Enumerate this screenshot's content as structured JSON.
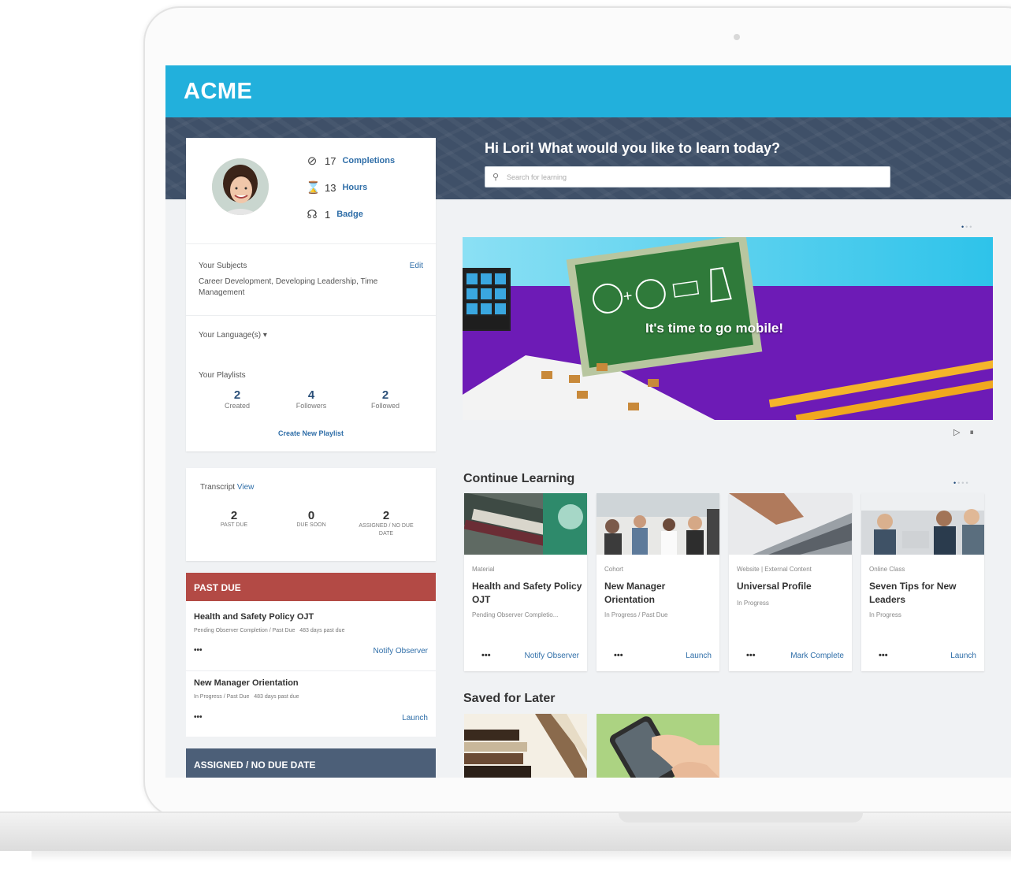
{
  "header": {
    "logo": "ACME"
  },
  "hero": {
    "greeting": "Hi Lori! What would you like to learn today?",
    "search_placeholder": "Search for learning"
  },
  "profile": {
    "stats": [
      {
        "icon": "check-circle-icon",
        "value": "17",
        "label": "Completions"
      },
      {
        "icon": "hourglass-icon",
        "value": "13",
        "label": "Hours"
      },
      {
        "icon": "badge-icon",
        "value": "1",
        "label": "Badge"
      }
    ],
    "subjects_label": "Your Subjects",
    "subjects_edit": "Edit",
    "subjects_value": "Career Development, Developing Leadership, Time Management",
    "languages_label": "Your Language(s)",
    "playlists_label": "Your Playlists",
    "playlists": [
      {
        "value": "2",
        "label": "Created"
      },
      {
        "value": "4",
        "label": "Followers"
      },
      {
        "value": "2",
        "label": "Followed"
      }
    ],
    "create_playlist": "Create New Playlist"
  },
  "transcript": {
    "label": "Transcript",
    "view": "View",
    "counts": [
      {
        "value": "2",
        "label": "PAST DUE"
      },
      {
        "value": "0",
        "label": "DUE SOON"
      },
      {
        "value": "2",
        "label": "ASSIGNED / NO DUE DATE"
      }
    ]
  },
  "past_due": {
    "header": "PAST DUE",
    "items": [
      {
        "title": "Health and Safety Policy OJT",
        "status": "Pending Observer Completion / Past Due",
        "days": "483 days past due",
        "more": "•••",
        "action": "Notify Observer"
      },
      {
        "title": "New Manager Orientation",
        "status": "In Progress / Past Due",
        "days": "483 days past due",
        "more": "•••",
        "action": "Launch"
      }
    ]
  },
  "assigned": {
    "header": "ASSIGNED / NO DUE DATE"
  },
  "banner": {
    "text": "It's time to go mobile!",
    "dots": "•••",
    "play": "▷",
    "pause": "⏸"
  },
  "continue_learning": {
    "title": "Continue Learning",
    "dots": "••••",
    "cards": [
      {
        "type": "Material",
        "title": "Health and Safety Policy OJT",
        "status": "Pending Observer Completio...",
        "more": "•••",
        "action": "Notify Observer"
      },
      {
        "type": "Cohort",
        "title": "New Manager Orientation",
        "status": "In Progress / Past Due",
        "more": "•••",
        "action": "Launch"
      },
      {
        "type": "Website | External Content",
        "title": "Universal Profile",
        "status": "In Progress",
        "more": "•••",
        "action": "Mark Complete"
      },
      {
        "type": "Online Class",
        "title": "Seven Tips for New Leaders",
        "status": "In Progress",
        "more": "•••",
        "action": "Launch"
      }
    ]
  },
  "saved_for_later": {
    "title": "Saved for Later"
  },
  "colors": {
    "topbar": "#22b0dc",
    "hero_band": "#3f5068",
    "past_due": "#b34a45",
    "assigned": "#4c5f78",
    "link": "#2f6ea8"
  }
}
